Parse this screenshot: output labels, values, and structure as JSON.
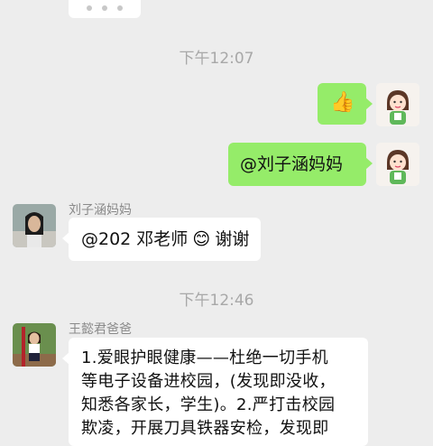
{
  "timestamps": {
    "t1": "下午12:07",
    "t2": "下午12:46"
  },
  "messages": {
    "thumbs_emoji": "👍",
    "mention_self": "@刘子涵妈妈",
    "liu_nick": "刘子涵妈妈",
    "liu_text": "@202 邓老师",
    "liu_emoji": "😊",
    "liu_thanks": " 谢谢",
    "wang_nick": "王懿君爸爸",
    "wang_line1": "1.爱眼护眼健康——杜绝一切手机",
    "wang_line2": "等电子设备进校园，(发现即没收，",
    "wang_line3": "知悉各家长，学生)。2.严打击校园",
    "wang_line4": "欺凌，开展刀具铁器安检，发现即"
  },
  "colors": {
    "background": "#ededed",
    "my_bubble": "#95ec69",
    "other_bubble": "#ffffff",
    "timestamp": "#a8a8a8"
  }
}
